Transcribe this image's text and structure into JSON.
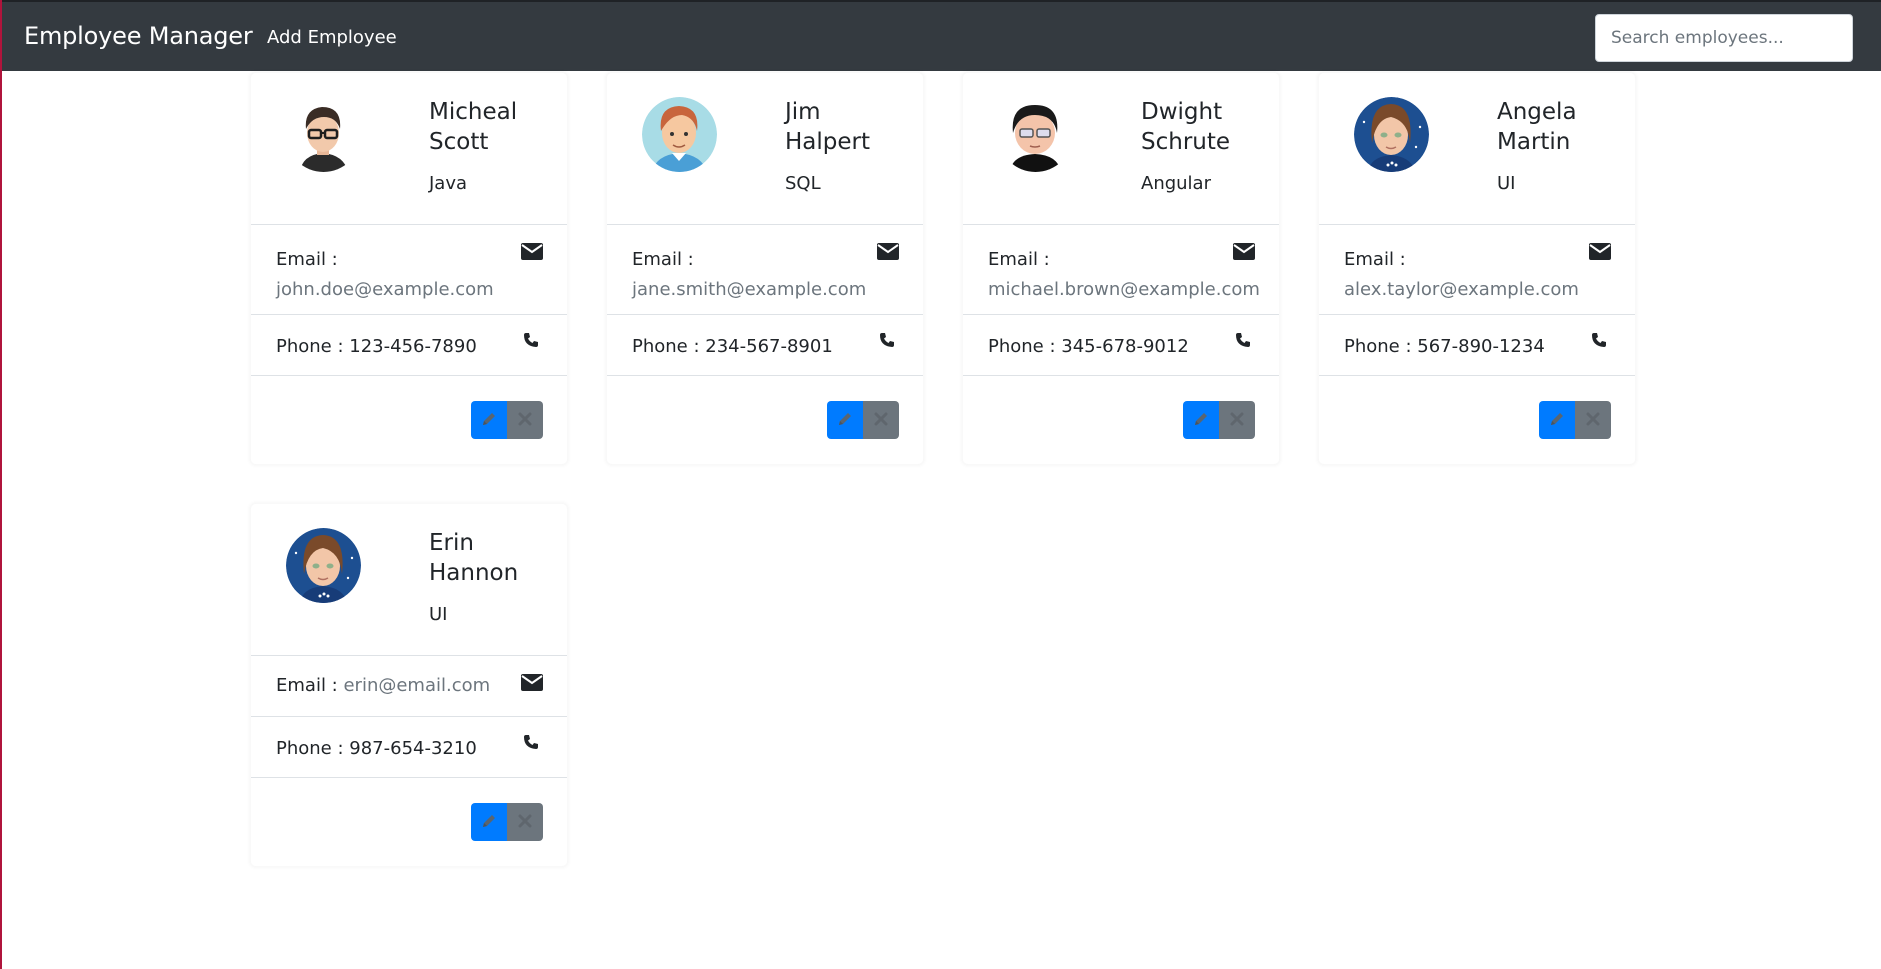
{
  "navbar": {
    "brand": "Employee Manager",
    "links": [
      {
        "label": "Add Employee"
      }
    ],
    "search": {
      "placeholder": "Search employees...",
      "value": ""
    }
  },
  "labels": {
    "email": "Email :",
    "phone": "Phone :"
  },
  "colors": {
    "navbar_bg": "#343a40",
    "edit_button": "#007bff",
    "delete_button": "#6c757d"
  },
  "employees": [
    {
      "name_first": "Micheal",
      "name_last": "Scott",
      "skill": "Java",
      "email": "john.doe@example.com",
      "phone": "123-456-7890",
      "avatar": "male-glasses-avatar"
    },
    {
      "name_first": "Jim",
      "name_last": "Halpert",
      "skill": "SQL",
      "email": "jane.smith@example.com",
      "phone": "234-567-8901",
      "avatar": "male-redhair-avatar"
    },
    {
      "name_first": "Dwight",
      "name_last": "Schrute",
      "skill": "Angular",
      "email": "michael.brown@example.com",
      "phone": "345-678-9012",
      "avatar": "male-cartoon-glasses-avatar"
    },
    {
      "name_first": "Angela",
      "name_last": "Martin",
      "skill": "UI",
      "email": "alex.taylor@example.com",
      "phone": "567-890-1234",
      "avatar": "female-avatar"
    },
    {
      "name_first": "Erin",
      "name_last": "Hannon",
      "skill": "UI",
      "email": "erin@email.com",
      "phone": "987-654-3210",
      "avatar": "female-avatar"
    }
  ],
  "icons": {
    "email": "envelope-icon",
    "phone": "phone-icon",
    "edit": "pencil-icon",
    "delete": "times-icon"
  }
}
